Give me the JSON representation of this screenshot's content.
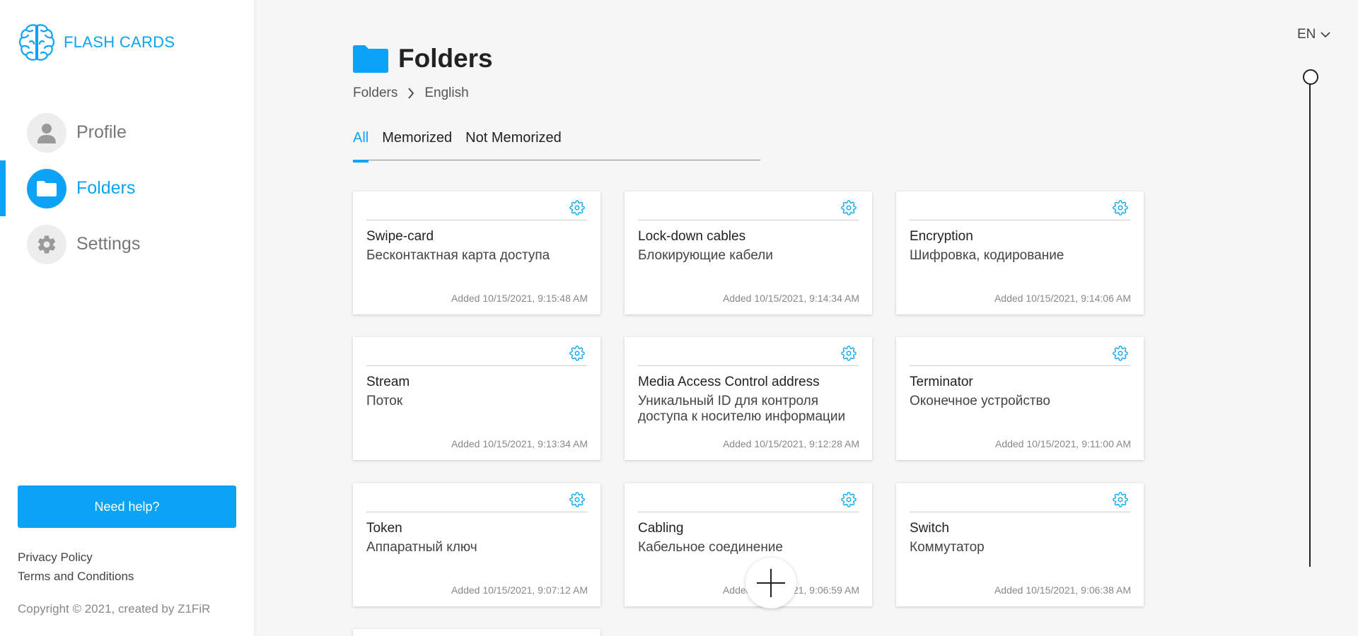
{
  "brand": {
    "name": "FLASH CARDS"
  },
  "sidebar": {
    "items": [
      {
        "label": "Profile"
      },
      {
        "label": "Folders"
      },
      {
        "label": "Settings"
      }
    ],
    "help_label": "Need help?",
    "privacy": "Privacy Policy",
    "terms": "Terms and Conditions",
    "copyright": "Copyright © 2021, created by Z1FiR"
  },
  "header": {
    "title": "Folders"
  },
  "breadcrumb": {
    "root": "Folders",
    "current": "English"
  },
  "tabs": [
    {
      "label": "All"
    },
    {
      "label": "Memorized"
    },
    {
      "label": "Not Memorized"
    }
  ],
  "cards": [
    {
      "term": "Swipe-card",
      "translation": "Бесконтактная карта доступа",
      "added": "Added 10/15/2021, 9:15:48 AM"
    },
    {
      "term": "Lock-down cables",
      "translation": "Блокирующие кабели",
      "added": "Added 10/15/2021, 9:14:34 AM"
    },
    {
      "term": "Encryption",
      "translation": "Шифровка, кодирование",
      "added": "Added 10/15/2021, 9:14:06 AM"
    },
    {
      "term": "Stream",
      "translation": "Поток",
      "added": "Added 10/15/2021, 9:13:34 AM"
    },
    {
      "term": "Media Access Control address",
      "translation": "Уникальный ID для контроля доступа к носителю информации",
      "added": "Added 10/15/2021, 9:12:28 AM"
    },
    {
      "term": "Terminator",
      "translation": "Оконечное устройство",
      "added": "Added 10/15/2021, 9:11:00 AM"
    },
    {
      "term": "Token",
      "translation": "Аппаратный ключ",
      "added": "Added 10/15/2021, 9:07:12 AM"
    },
    {
      "term": "Cabling",
      "translation": "Кабельное соединение",
      "added": "Added 10/15/2021, 9:06:59 AM"
    },
    {
      "term": "Switch",
      "translation": "Коммутатор",
      "added": "Added 10/15/2021, 9:06:38 AM"
    }
  ],
  "language": {
    "current": "EN"
  },
  "colors": {
    "accent": "#0aa3f5",
    "background": "#f6f6f6"
  },
  "icons": {
    "brand": "brain-icon",
    "profile": "user-icon",
    "folders": "folder-icon",
    "settings": "gear-icon",
    "card_settings": "gear-icon",
    "add": "plus-icon",
    "breadcrumb_separator": "chevron-right-icon",
    "language_dropdown": "chevron-down-icon"
  }
}
